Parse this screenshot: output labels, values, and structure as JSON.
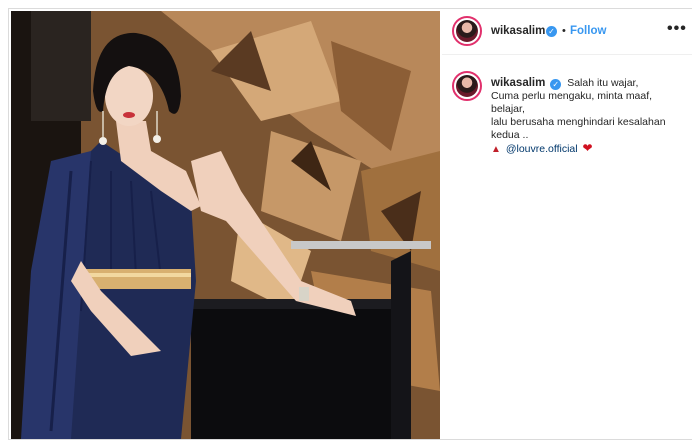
{
  "post": {
    "username": "wikasalim",
    "follow_label": "Follow",
    "separator": "•",
    "more_label": "•••",
    "verified_glyph": "✓"
  },
  "caption": {
    "username": "wikasalim",
    "lines": [
      "Salah itu wajar,",
      "Cuma perlu mengaku, minta maaf,",
      "belajar,",
      "lalu berusaha menghindari kesalahan",
      "kedua .."
    ],
    "mention": "@louvre.official",
    "emoji_before": "dress-emoji",
    "emoji_after": "red-heart-emoji"
  },
  "colors": {
    "accent": "#3897f0",
    "mention": "#00376b",
    "dress_navy": "#1f2a55",
    "belt_gold": "#d8b070"
  }
}
